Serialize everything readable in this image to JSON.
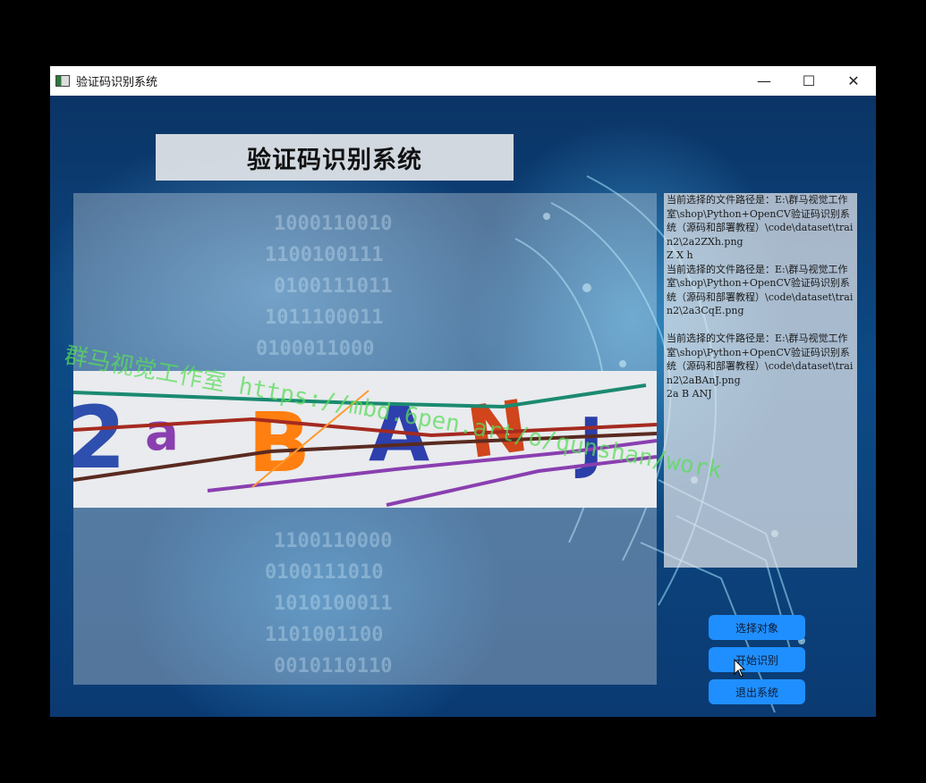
{
  "window": {
    "title": "验证码识别系统",
    "controls": {
      "minimize": "—",
      "maximize": "☐",
      "close": "✕"
    }
  },
  "header": {
    "title": "验证码识别系统"
  },
  "captcha": {
    "characters": [
      "2",
      "a",
      "B",
      "A",
      "N",
      "J"
    ]
  },
  "log": {
    "lines": [
      "当前选择的文件路径是：E:\\群马视觉工作室\\shop\\Python+OpenCV验证码识别系统（源码和部署教程）\\code\\dataset\\train2\\2a2ZXh.png",
      "Z X h",
      "当前选择的文件路径是：E:\\群马视觉工作室\\shop\\Python+OpenCV验证码识别系统（源码和部署教程）\\code\\dataset\\train2\\2a3CqE.png",
      "",
      "当前选择的文件路径是：E:\\群马视觉工作室\\shop\\Python+OpenCV验证码识别系统（源码和部署教程）\\code\\dataset\\train2\\2aBAnJ.png",
      "2a B ANJ"
    ]
  },
  "buttons": {
    "select": "选择对象",
    "recognize": "开始识别",
    "exit": "退出系统"
  },
  "watermark": {
    "text": "群马视觉工作室 https://mbd.6pen.art/o/qunshan/work"
  },
  "colors": {
    "button_bg": "#1f8fff",
    "title_bar": "#ffffff",
    "watermark": "#5adc5a"
  }
}
